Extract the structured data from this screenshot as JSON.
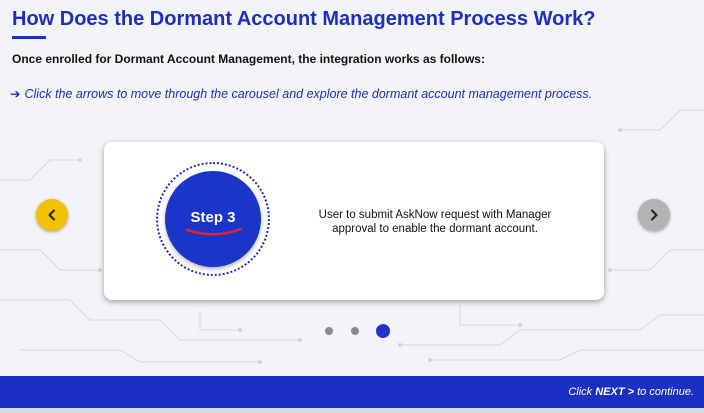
{
  "header": {
    "title": "How Does the Dormant Account Management Process Work?",
    "intro": "Once enrolled for Dormant Account Management, the integration works as follows:",
    "instruction_arrow": "➔",
    "instruction": "Click the arrows to move through the carousel and explore the dormant account management process."
  },
  "carousel": {
    "step_label": "Step 3",
    "step_text": "User to submit AskNow request with Manager approval to enable the dormant account.",
    "current_slide": 3,
    "total_slides": 3,
    "prev_icon": "chevron-left-icon",
    "next_icon": "chevron-right-icon"
  },
  "footer": {
    "prefix": "Click",
    "next_label": "NEXT >",
    "suffix": "to continue."
  },
  "colors": {
    "brand_blue": "#1b2fc2",
    "prev_button": "#f2c200",
    "next_button": "#b3b3b3",
    "swoosh": "#e0242f"
  }
}
